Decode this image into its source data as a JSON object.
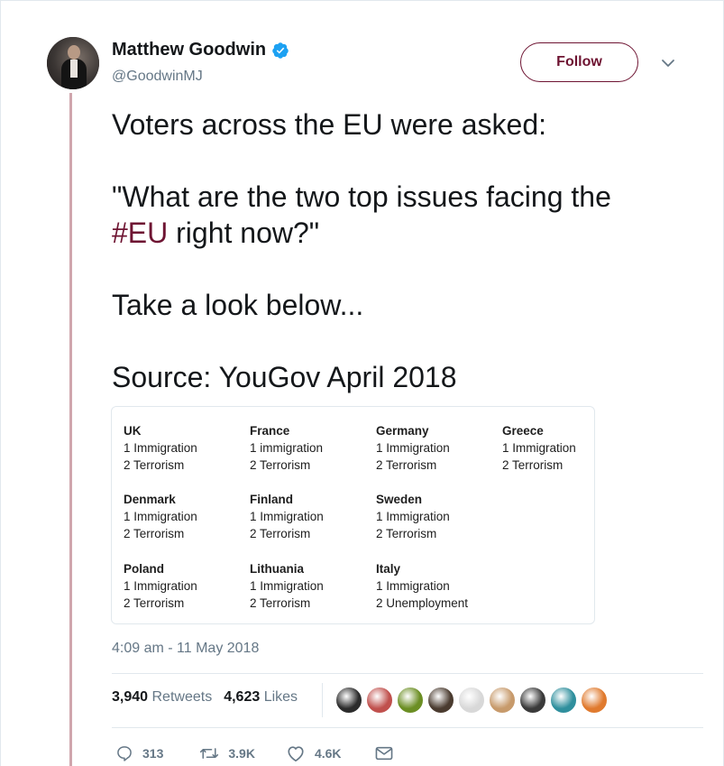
{
  "author": {
    "name": "Matthew Goodwin",
    "handle": "@GoodwinMJ",
    "verified": true,
    "follow_label": "Follow"
  },
  "tweet": {
    "lines": [
      "Voters across the EU were asked:",
      "\"What are the two top issues facing the",
      "#EU",
      " right now?\"",
      "Take a look below...",
      "Source: YouGov April 2018"
    ]
  },
  "card": {
    "countries": [
      {
        "name": "UK",
        "issue1": "1 Immigration",
        "issue2": "2 Terrorism"
      },
      {
        "name": "France",
        "issue1": "1 immigration",
        "issue2": "2 Terrorism"
      },
      {
        "name": "Germany",
        "issue1": "1 Immigration",
        "issue2": "2 Terrorism"
      },
      {
        "name": "Greece",
        "issue1": "1 Immigration",
        "issue2": "2 Terrorism"
      },
      {
        "name": "Denmark",
        "issue1": "1 Immigration",
        "issue2": "2 Terrorism"
      },
      {
        "name": "Finland",
        "issue1": "1 Immigration",
        "issue2": "2 Terrorism"
      },
      {
        "name": "Sweden",
        "issue1": "1 Immigration",
        "issue2": "2 Terrorism"
      },
      {
        "name": "Poland",
        "issue1": "1 Immigration",
        "issue2": "2 Terrorism"
      },
      {
        "name": "Lithuania",
        "issue1": "1 Immigration",
        "issue2": "2 Terrorism"
      },
      {
        "name": "Italy",
        "issue1": "1 Immigration",
        "issue2": "2 Unemployment"
      }
    ]
  },
  "timestamp": "4:09 am - 11 May 2018",
  "stats": {
    "retweets_count": "3,940",
    "retweets_label": "Retweets",
    "likes_count": "4,623",
    "likes_label": "Likes"
  },
  "likers": {
    "colors": [
      "#2b2b2b",
      "#c0504d",
      "#6b8e23",
      "#4a3b2f",
      "#d8d8d8",
      "#c79a6b",
      "#3a3a3a",
      "#2f8f9d",
      "#e07a2e"
    ]
  },
  "actions": {
    "replies": "313",
    "retweets": "3.9K",
    "likes": "4.6K"
  },
  "colors": {
    "accent": "#6e1432",
    "muted": "#657786",
    "verified": "#1da1f2",
    "thread_line": "#d0a6ad"
  }
}
